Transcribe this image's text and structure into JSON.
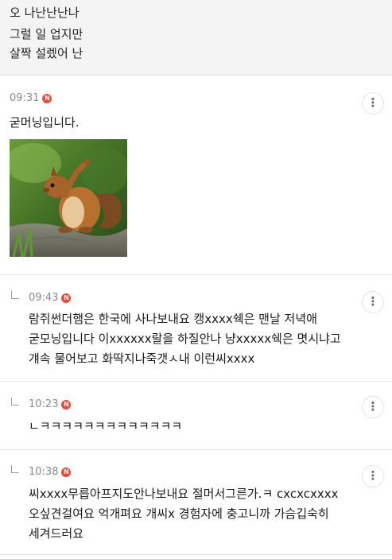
{
  "top_post": {
    "lines": [
      "오 나난난난나",
      "그럴 일 업지만",
      "살짝 설렜어 난"
    ]
  },
  "comments": [
    {
      "time": "09:31",
      "badge": "N",
      "text_lines": [
        "굳머닝입니다."
      ],
      "has_image": true,
      "image_icon": "squirrel-photo"
    },
    {
      "time": "09:43",
      "badge": "N",
      "reply": true,
      "text_lines": [
        "람쥐썬더햄은 한국에 사나보내요 캥xxxx쉑은 맨날 저녁애",
        "굳모닝입니다 이xxxxxx랄을 하질안나 냥xxxxx쉑은 몃시냐고",
        "걔속 물어보고 화딱지나죽갯ㅅ내 이런씨xxxx"
      ]
    },
    {
      "time": "10:23",
      "badge": "N",
      "reply": true,
      "text_lines": [
        "ㄴㅋㅋㅋㅋㅋㅋㅋㅋㅋㅋㅋㅋㅋ"
      ]
    },
    {
      "time": "10:38",
      "badge": "N",
      "reply": true,
      "text_lines": [
        "씨xxxx무릅아프지도안나보내요 절머서그른가.ㅋ cxcxcxxxx",
        "오싶견걸여요 억개펴요 개씨x 경험자에 충고니까 가슴깁숙히",
        "세겨드러요"
      ]
    }
  ],
  "more_icon": "more-vertical-icon",
  "colors": {
    "badge": "#e74c3c",
    "time": "#8a8a8a",
    "top_bg": "#f4f4f4"
  }
}
